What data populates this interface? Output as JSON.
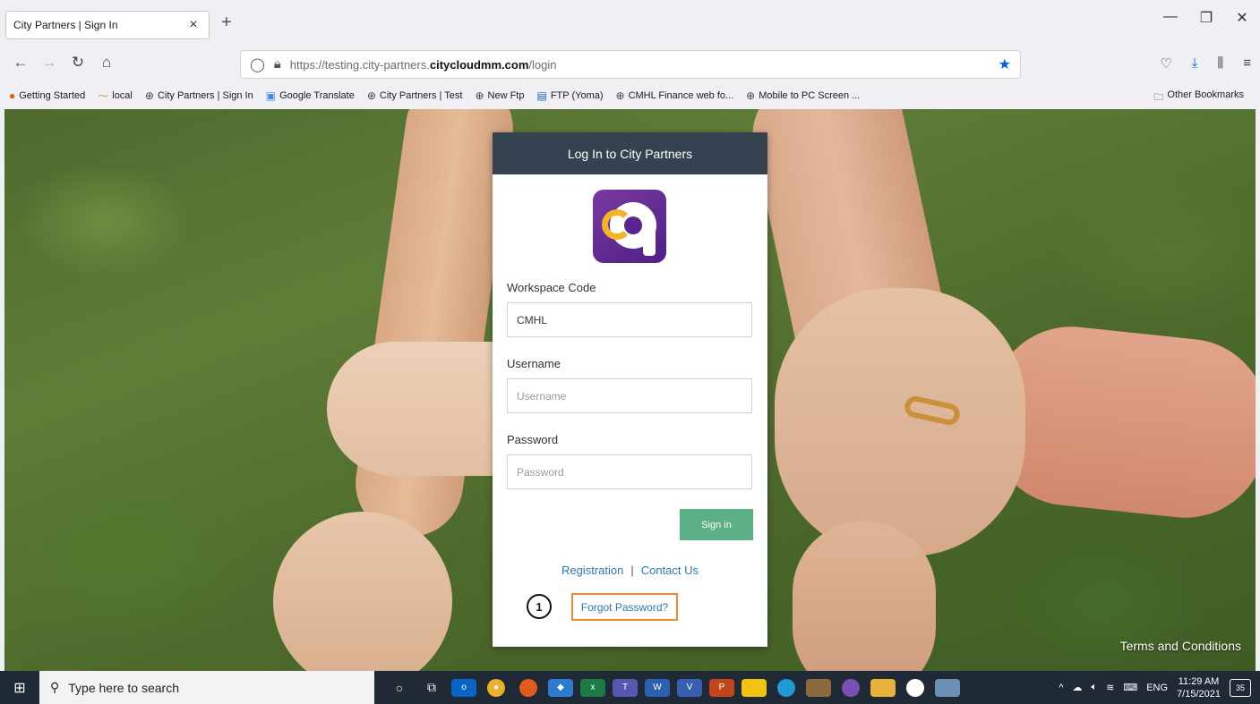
{
  "browser": {
    "tab_title": "City Partners | Sign In",
    "tab_close": "×",
    "new_tab": "+",
    "url_prefix": "https://testing.city-partners.",
    "url_domain": "citycloudmm.com",
    "url_path": "/login"
  },
  "bookmarks": {
    "items": [
      {
        "label": "Getting Started",
        "icon": "firefox-icon"
      },
      {
        "label": "local",
        "icon": "local-icon"
      },
      {
        "label": "City Partners | Sign In",
        "icon": "globe-icon"
      },
      {
        "label": "Google Translate",
        "icon": "google-translate-icon"
      },
      {
        "label": "City Partners | Test",
        "icon": "globe-icon"
      },
      {
        "label": "New Ftp",
        "icon": "globe-icon"
      },
      {
        "label": "FTP (Yoma)",
        "icon": "ftp-icon"
      },
      {
        "label": "CMHL Finance web fo...",
        "icon": "globe-icon"
      },
      {
        "label": "Mobile to PC Screen ...",
        "icon": "globe-icon"
      }
    ],
    "other": "Other Bookmarks"
  },
  "login": {
    "header": "Log In to City Partners",
    "workspace_label": "Workspace Code",
    "workspace_value": "CMHL",
    "username_label": "Username",
    "username_placeholder": "Username",
    "password_label": "Password",
    "password_placeholder": "Password",
    "signin_label": "Sign in",
    "registration": "Registration",
    "separator": "|",
    "contact": "Contact Us",
    "forgot": "Forgot Password?",
    "step_number": "1"
  },
  "page": {
    "terms": "Terms and Conditions"
  },
  "taskbar": {
    "search_placeholder": "Type here to search",
    "language": "ENG",
    "time": "11:29 AM",
    "date": "7/15/2021",
    "notifications": "35"
  },
  "colors": {
    "card_header": "#34434f",
    "signin_button": "#5cb085",
    "link": "#2a7ab8",
    "highlight_box": "#ec8b2e",
    "bookmark_star": "#0061e0"
  }
}
